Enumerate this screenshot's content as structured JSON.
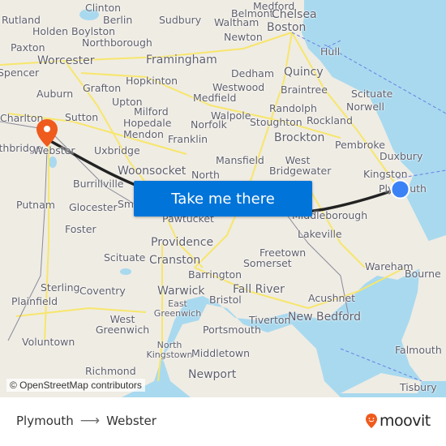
{
  "map": {
    "cta_label": "Take me there",
    "attribution": "© OpenStreetMap contributors",
    "origin": "Plymouth",
    "destination": "Webster",
    "colors": {
      "water": "#a8d9ef",
      "land": "#efece4",
      "road": "#f7e66b",
      "route": "#222222",
      "origin_dot": "#3b82f6",
      "destination_pin": "#ef5a1d",
      "cta": "#0074d9"
    },
    "places": [
      {
        "name": "Rutland"
      },
      {
        "name": "Clinton"
      },
      {
        "name": "Berlin"
      },
      {
        "name": "Holden"
      },
      {
        "name": "Boylston"
      },
      {
        "name": "Northborough"
      },
      {
        "name": "Paxton"
      },
      {
        "name": "Worcester"
      },
      {
        "name": "Spencer"
      },
      {
        "name": "Auburn"
      },
      {
        "name": "Grafton"
      },
      {
        "name": "Hopkinton"
      },
      {
        "name": "Sudbury"
      },
      {
        "name": "Medford"
      },
      {
        "name": "Belmont"
      },
      {
        "name": "Chelsea"
      },
      {
        "name": "Waltham"
      },
      {
        "name": "Boston"
      },
      {
        "name": "Newton"
      },
      {
        "name": "Framingham"
      },
      {
        "name": "Hull"
      },
      {
        "name": "Dedham"
      },
      {
        "name": "Quincy"
      },
      {
        "name": "Westwood"
      },
      {
        "name": "Braintree"
      },
      {
        "name": "Medfield"
      },
      {
        "name": "Scituate"
      },
      {
        "name": "Upton"
      },
      {
        "name": "Milford"
      },
      {
        "name": "Walpole"
      },
      {
        "name": "Randolph"
      },
      {
        "name": "Norwell"
      },
      {
        "name": "Charlton"
      },
      {
        "name": "Sutton"
      },
      {
        "name": "Hopedale"
      },
      {
        "name": "Norfolk"
      },
      {
        "name": "Stoughton"
      },
      {
        "name": "Rockland"
      },
      {
        "name": "Mendon"
      },
      {
        "name": "Franklin"
      },
      {
        "name": "Brockton"
      },
      {
        "name": "Pembroke"
      },
      {
        "name": "Southbridge"
      },
      {
        "name": "Webster"
      },
      {
        "name": "Uxbridge"
      },
      {
        "name": "Duxbury"
      },
      {
        "name": "Mansfield"
      },
      {
        "name": "West Bridgewater"
      },
      {
        "name": "Woonsocket"
      },
      {
        "name": "North"
      },
      {
        "name": "Kingston"
      },
      {
        "name": "Burrillville"
      },
      {
        "name": "Plymouth"
      },
      {
        "name": "Putnam"
      },
      {
        "name": "Glocester"
      },
      {
        "name": "Smithfield"
      },
      {
        "name": "Pawtucket"
      },
      {
        "name": "Middleborough"
      },
      {
        "name": "Lakeville"
      },
      {
        "name": "Foster"
      },
      {
        "name": "Providence"
      },
      {
        "name": "Scituate"
      },
      {
        "name": "Freetown"
      },
      {
        "name": "Cranston"
      },
      {
        "name": "Somerset"
      },
      {
        "name": "Wareham"
      },
      {
        "name": "Barrington"
      },
      {
        "name": "Bourne"
      },
      {
        "name": "Sterling"
      },
      {
        "name": "Coventry"
      },
      {
        "name": "Warwick"
      },
      {
        "name": "Fall River"
      },
      {
        "name": "Plainfield"
      },
      {
        "name": "Bristol"
      },
      {
        "name": "Acushnet"
      },
      {
        "name": "East Greenwich"
      },
      {
        "name": "West Greenwich"
      },
      {
        "name": "New Bedford"
      },
      {
        "name": "Tiverton"
      },
      {
        "name": "Portsmouth"
      },
      {
        "name": "Voluntown"
      },
      {
        "name": "North Kingstown"
      },
      {
        "name": "Middletown"
      },
      {
        "name": "Falmouth"
      },
      {
        "name": "Richmond"
      },
      {
        "name": "Newport"
      },
      {
        "name": "Tisbury"
      }
    ]
  },
  "footer": {
    "origin": "Plymouth",
    "arrow": "⟶",
    "destination": "Webster",
    "logo_text": "moovit",
    "logo_color": "#ef5a1d"
  }
}
